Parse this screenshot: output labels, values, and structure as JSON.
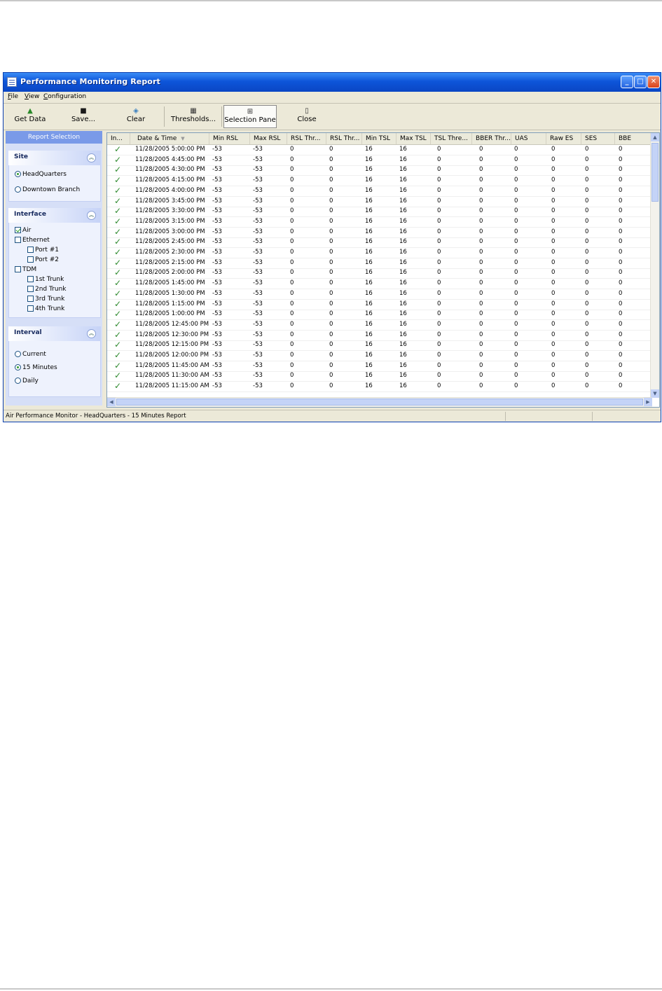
{
  "window": {
    "title": "Performance Monitoring Report",
    "controls": {
      "minimize": "_",
      "maximize": "□",
      "close": "✕"
    }
  },
  "menu": [
    "File",
    "View",
    "Configuration"
  ],
  "toolbar": [
    {
      "label": "Get Data",
      "icon": "get-data-icon"
    },
    {
      "label": "Save...",
      "icon": "save-icon"
    },
    {
      "label": "Clear",
      "icon": "clear-icon"
    },
    {
      "label": "Thresholds...",
      "icon": "thresholds-icon"
    },
    {
      "label": "Selection Pane",
      "icon": "selection-pane-icon",
      "active": true
    },
    {
      "label": "Close",
      "icon": "close-door-icon"
    }
  ],
  "sidebar": {
    "header": "Report Selection",
    "site": {
      "title": "Site",
      "options": [
        {
          "label": "HeadQuarters",
          "selected": true
        },
        {
          "label": "Downtown Branch",
          "selected": false
        }
      ]
    },
    "interface": {
      "title": "Interface",
      "items": [
        {
          "label": "Air",
          "checked": true
        },
        {
          "label": "Ethernet",
          "checked": false
        },
        {
          "label": "Port #1",
          "checked": false
        },
        {
          "label": "Port #2",
          "checked": false
        },
        {
          "label": "TDM",
          "checked": false
        },
        {
          "label": "1st Trunk",
          "checked": false
        },
        {
          "label": "2nd Trunk",
          "checked": false
        },
        {
          "label": "3rd Trunk",
          "checked": false
        },
        {
          "label": "4th Trunk",
          "checked": false
        }
      ]
    },
    "interval": {
      "title": "Interval",
      "options": [
        {
          "label": "Current",
          "selected": false
        },
        {
          "label": "15 Minutes",
          "selected": true
        },
        {
          "label": "Daily",
          "selected": false
        }
      ]
    }
  },
  "table": {
    "columns": [
      "In...",
      "Date & Time",
      "Min RSL",
      "Max RSL",
      "RSL Thr...",
      "RSL Thr...",
      "Min TSL",
      "Max TSL",
      "TSL Thre...",
      "BBER Thr...",
      "UAS",
      "Raw ES",
      "SES",
      "BBE"
    ],
    "rows": [
      [
        "11/28/2005 5:00:00 PM",
        "-53",
        "-53",
        "0",
        "0",
        "16",
        "16",
        "0",
        "0",
        "0",
        "0",
        "0",
        "0"
      ],
      [
        "11/28/2005 4:45:00 PM",
        "-53",
        "-53",
        "0",
        "0",
        "16",
        "16",
        "0",
        "0",
        "0",
        "0",
        "0",
        "0"
      ],
      [
        "11/28/2005 4:30:00 PM",
        "-53",
        "-53",
        "0",
        "0",
        "16",
        "16",
        "0",
        "0",
        "0",
        "0",
        "0",
        "0"
      ],
      [
        "11/28/2005 4:15:00 PM",
        "-53",
        "-53",
        "0",
        "0",
        "16",
        "16",
        "0",
        "0",
        "0",
        "0",
        "0",
        "0"
      ],
      [
        "11/28/2005 4:00:00 PM",
        "-53",
        "-53",
        "0",
        "0",
        "16",
        "16",
        "0",
        "0",
        "0",
        "0",
        "0",
        "0"
      ],
      [
        "11/28/2005 3:45:00 PM",
        "-53",
        "-53",
        "0",
        "0",
        "16",
        "16",
        "0",
        "0",
        "0",
        "0",
        "0",
        "0"
      ],
      [
        "11/28/2005 3:30:00 PM",
        "-53",
        "-53",
        "0",
        "0",
        "16",
        "16",
        "0",
        "0",
        "0",
        "0",
        "0",
        "0"
      ],
      [
        "11/28/2005 3:15:00 PM",
        "-53",
        "-53",
        "0",
        "0",
        "16",
        "16",
        "0",
        "0",
        "0",
        "0",
        "0",
        "0"
      ],
      [
        "11/28/2005 3:00:00 PM",
        "-53",
        "-53",
        "0",
        "0",
        "16",
        "16",
        "0",
        "0",
        "0",
        "0",
        "0",
        "0"
      ],
      [
        "11/28/2005 2:45:00 PM",
        "-53",
        "-53",
        "0",
        "0",
        "16",
        "16",
        "0",
        "0",
        "0",
        "0",
        "0",
        "0"
      ],
      [
        "11/28/2005 2:30:00 PM",
        "-53",
        "-53",
        "0",
        "0",
        "16",
        "16",
        "0",
        "0",
        "0",
        "0",
        "0",
        "0"
      ],
      [
        "11/28/2005 2:15:00 PM",
        "-53",
        "-53",
        "0",
        "0",
        "16",
        "16",
        "0",
        "0",
        "0",
        "0",
        "0",
        "0"
      ],
      [
        "11/28/2005 2:00:00 PM",
        "-53",
        "-53",
        "0",
        "0",
        "16",
        "16",
        "0",
        "0",
        "0",
        "0",
        "0",
        "0"
      ],
      [
        "11/28/2005 1:45:00 PM",
        "-53",
        "-53",
        "0",
        "0",
        "16",
        "16",
        "0",
        "0",
        "0",
        "0",
        "0",
        "0"
      ],
      [
        "11/28/2005 1:30:00 PM",
        "-53",
        "-53",
        "0",
        "0",
        "16",
        "16",
        "0",
        "0",
        "0",
        "0",
        "0",
        "0"
      ],
      [
        "11/28/2005 1:15:00 PM",
        "-53",
        "-53",
        "0",
        "0",
        "16",
        "16",
        "0",
        "0",
        "0",
        "0",
        "0",
        "0"
      ],
      [
        "11/28/2005 1:00:00 PM",
        "-53",
        "-53",
        "0",
        "0",
        "16",
        "16",
        "0",
        "0",
        "0",
        "0",
        "0",
        "0"
      ],
      [
        "11/28/2005 12:45:00 PM",
        "-53",
        "-53",
        "0",
        "0",
        "16",
        "16",
        "0",
        "0",
        "0",
        "0",
        "0",
        "0"
      ],
      [
        "11/28/2005 12:30:00 PM",
        "-53",
        "-53",
        "0",
        "0",
        "16",
        "16",
        "0",
        "0",
        "0",
        "0",
        "0",
        "0"
      ],
      [
        "11/28/2005 12:15:00 PM",
        "-53",
        "-53",
        "0",
        "0",
        "16",
        "16",
        "0",
        "0",
        "0",
        "0",
        "0",
        "0"
      ],
      [
        "11/28/2005 12:00:00 PM",
        "-53",
        "-53",
        "0",
        "0",
        "16",
        "16",
        "0",
        "0",
        "0",
        "0",
        "0",
        "0"
      ],
      [
        "11/28/2005 11:45:00 AM",
        "-53",
        "-53",
        "0",
        "0",
        "16",
        "16",
        "0",
        "0",
        "0",
        "0",
        "0",
        "0"
      ],
      [
        "11/28/2005 11:30:00 AM",
        "-53",
        "-53",
        "0",
        "0",
        "16",
        "16",
        "0",
        "0",
        "0",
        "0",
        "0",
        "0"
      ],
      [
        "11/28/2005 11:15:00 AM",
        "-53",
        "-53",
        "0",
        "0",
        "16",
        "16",
        "0",
        "0",
        "0",
        "0",
        "0",
        "0"
      ]
    ]
  },
  "status": {
    "text": "Air Performance Monitor - HeadQuarters - 15 Minutes Report"
  },
  "colors": {
    "titlebar": "#0d55d9",
    "check_mark": "#2e8a2e",
    "sidebar": "#d6dff7"
  }
}
